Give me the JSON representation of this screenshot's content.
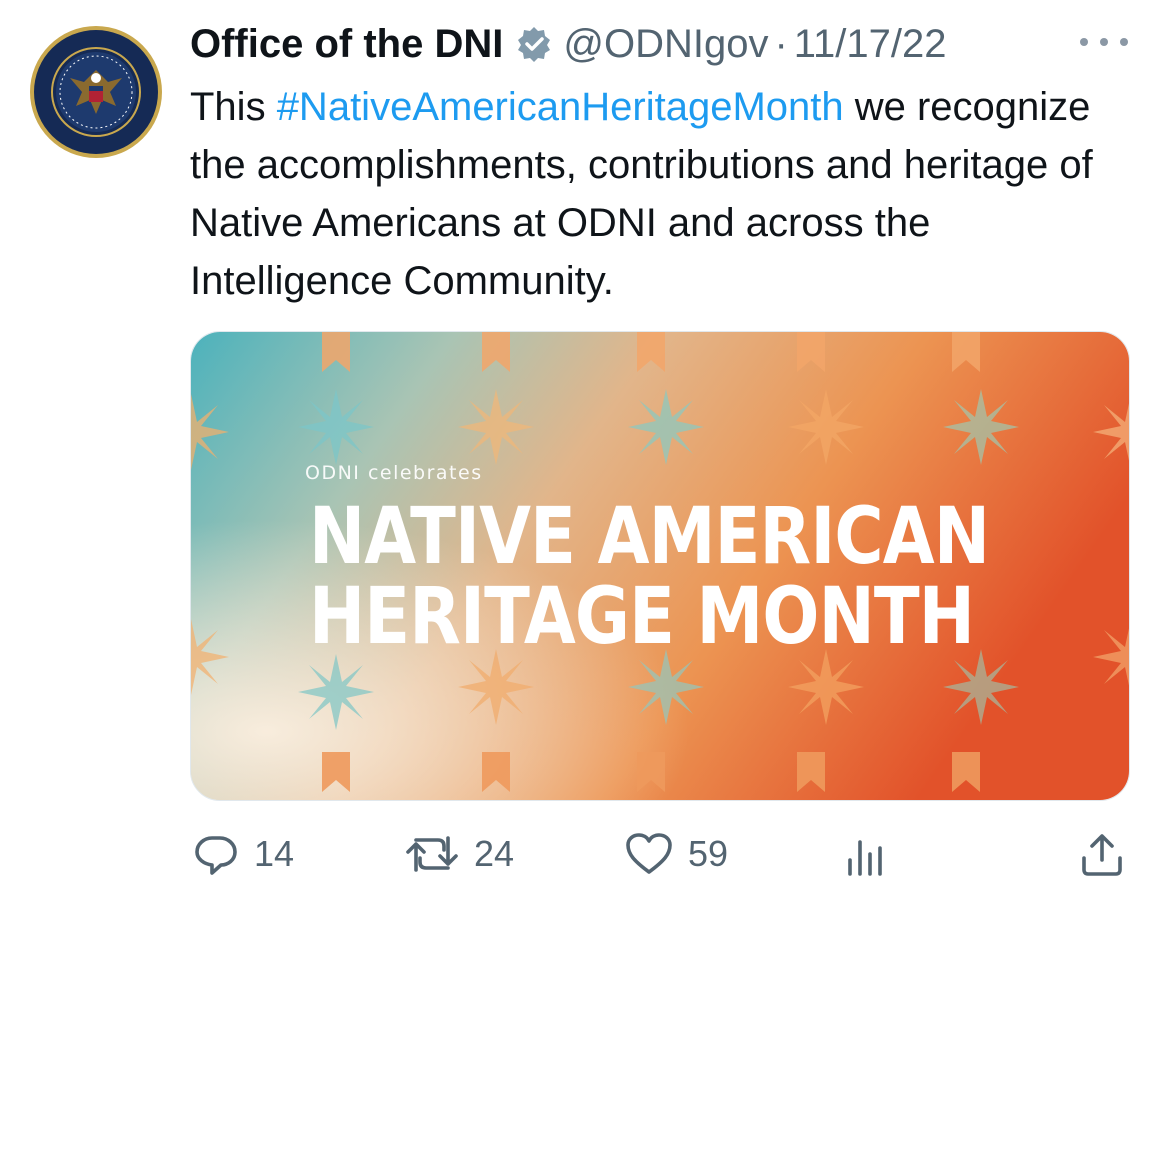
{
  "tweet": {
    "author_name": "Office of the DNI",
    "handle": "@ODNIgov",
    "separator": "·",
    "date": "11/17/22",
    "text_before": "This ",
    "hashtag": "#NativeAmericanHeritageMonth",
    "text_after": " we recognize the accomplishments, contributions and heritage of Native Americans at ODNI and across the Intelligence Community."
  },
  "media": {
    "kicker": "ODNI celebrates",
    "title_line1": "NATIVE AMERICAN",
    "title_line2": "HERITAGE MONTH"
  },
  "actions": {
    "replies": "14",
    "retweets": "24",
    "likes": "59"
  },
  "icons": {
    "verified": "verified-badge-icon",
    "more": "more-icon",
    "reply": "reply-icon",
    "retweet": "retweet-icon",
    "like": "like-icon",
    "views": "views-icon",
    "share": "share-icon"
  },
  "colors": {
    "hashtag": "#1d9bf0",
    "secondary_text": "#536471",
    "primary_text": "#0f1419"
  }
}
